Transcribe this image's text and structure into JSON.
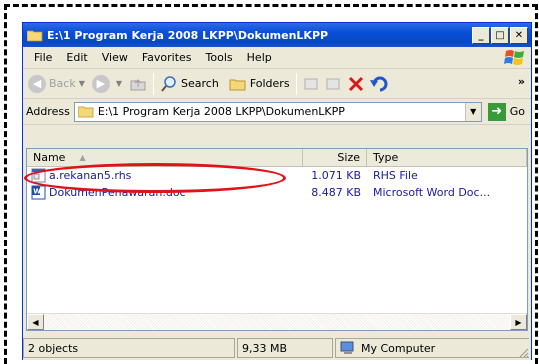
{
  "window": {
    "title": "E:\\1 Program Kerja 2008 LKPP\\DokumenLKPP"
  },
  "menu": [
    "File",
    "Edit",
    "View",
    "Favorites",
    "Tools",
    "Help"
  ],
  "toolbar": {
    "back": "Back",
    "search": "Search",
    "folders": "Folders"
  },
  "address": {
    "label": "Address",
    "value": "E:\\1 Program Kerja 2008 LKPP\\DokumenLKPP",
    "go": "Go"
  },
  "columns": {
    "name": "Name",
    "size": "Size",
    "type": "Type"
  },
  "files": [
    {
      "name": "a.rekanan5.rhs",
      "size": "1.071 KB",
      "type": "RHS File",
      "icon": "rhs-file-icon"
    },
    {
      "name": "DokumenPenawaran.doc",
      "size": "8.487 KB",
      "type": "Microsoft Word Doc...",
      "icon": "word-doc-icon"
    }
  ],
  "status": {
    "objects": "2 objects",
    "size": "9,33 MB",
    "location": "My Computer"
  },
  "colors": {
    "titlebar": "#0a4fd8",
    "highlight": "#e0121a",
    "link": "#1a1aa0"
  }
}
